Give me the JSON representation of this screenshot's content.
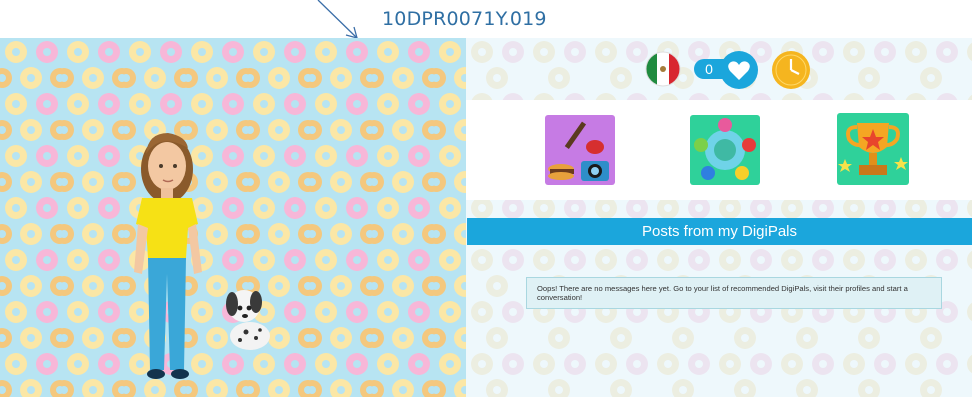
{
  "header": {
    "id_label": "10DPR0071Y.019"
  },
  "status_bar": {
    "flag": "mexico-flag-icon",
    "likes_count": "0",
    "heart": "heart-icon",
    "clock": "clock-icon"
  },
  "activities": [
    {
      "name": "hobbies-activity",
      "icon": "guitar-burger-camera-icon"
    },
    {
      "name": "community-activity",
      "icon": "people-circle-icon"
    },
    {
      "name": "achievements-activity",
      "icon": "trophy-stars-icon"
    }
  ],
  "posts": {
    "heading": "Posts from my DigiPals",
    "empty_message": "Oops! There are no messages here yet. Go to your list of recommended DigiPals, visit their profiles and start a conversation!"
  },
  "colors": {
    "accent": "#1ba6dc",
    "background": "#b7e4f2",
    "label": "#2f6fa3"
  }
}
